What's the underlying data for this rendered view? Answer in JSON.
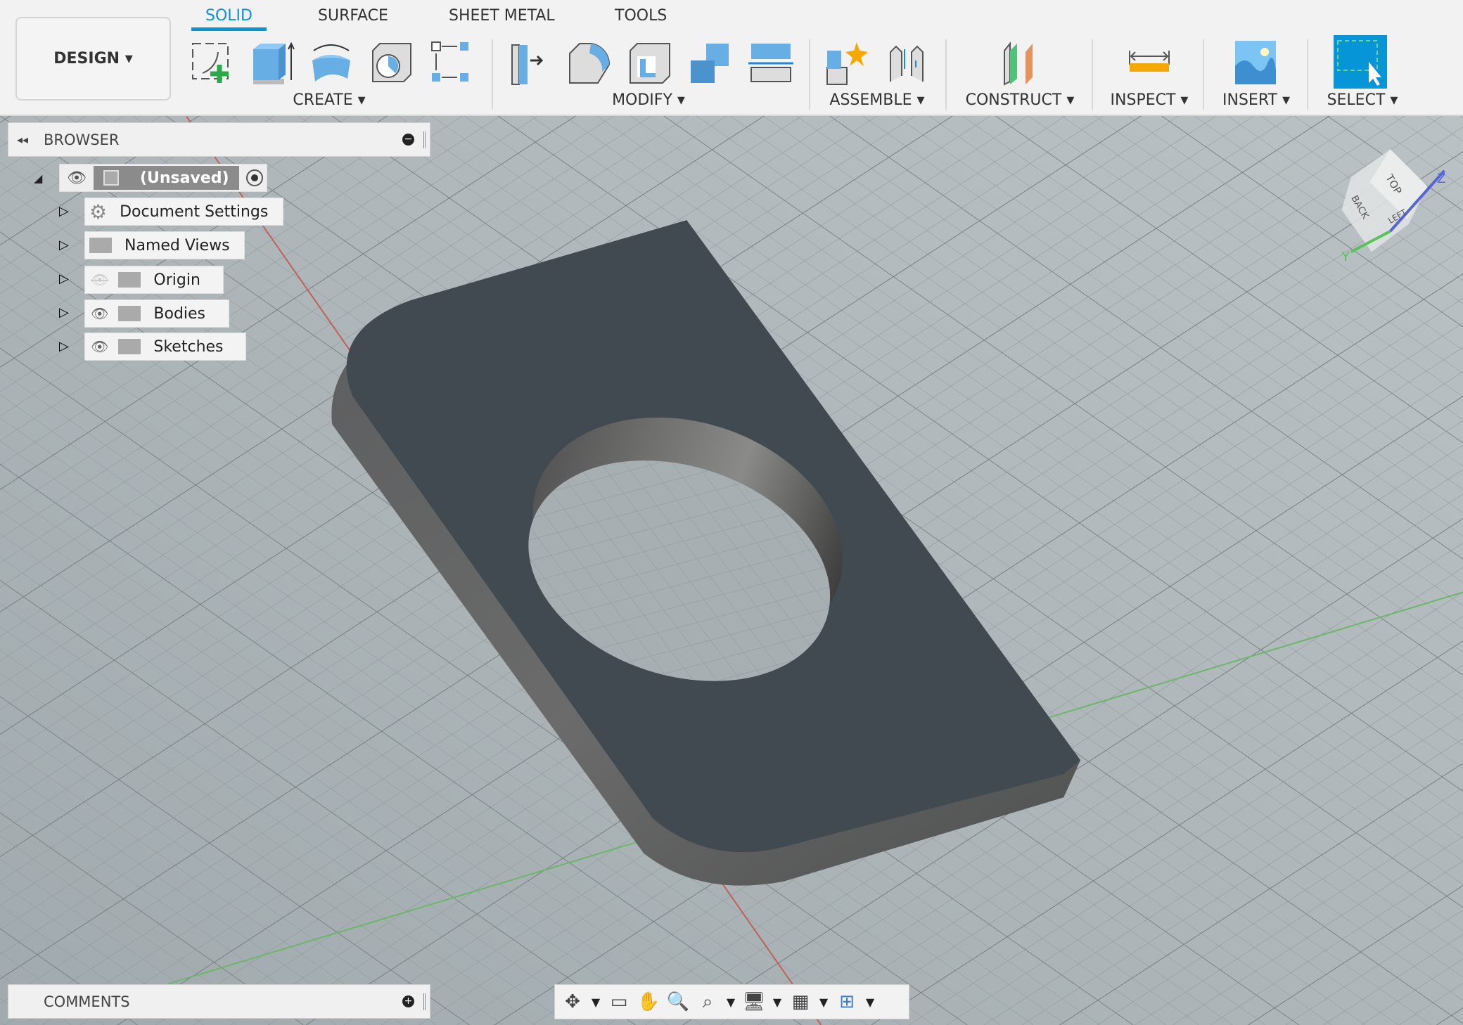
{
  "toolbar": {
    "workspace": "DESIGN",
    "tabs": [
      {
        "label": "SOLID",
        "active": true
      },
      {
        "label": "SURFACE",
        "active": false
      },
      {
        "label": "SHEET METAL",
        "active": false
      },
      {
        "label": "TOOLS",
        "active": false
      }
    ],
    "groups": [
      {
        "label": "CREATE",
        "icons": [
          "create-sketch-icon",
          "extrude-icon",
          "revolve-icon",
          "hole-icon",
          "pattern-icon"
        ]
      },
      {
        "label": "MODIFY",
        "icons": [
          "press-pull-icon",
          "fillet-icon",
          "shell-icon",
          "combine-icon",
          "split-body-icon"
        ]
      },
      {
        "label": "ASSEMBLE",
        "icons": [
          "new-component-icon",
          "joint-icon"
        ]
      },
      {
        "label": "CONSTRUCT",
        "icons": [
          "offset-plane-icon"
        ]
      },
      {
        "label": "INSPECT",
        "icons": [
          "measure-icon"
        ]
      },
      {
        "label": "INSERT",
        "icons": [
          "insert-image-icon"
        ]
      },
      {
        "label": "SELECT",
        "icons": [
          "select-icon"
        ]
      }
    ],
    "accent": "#0696d7"
  },
  "browser": {
    "title": "BROWSER",
    "root": "(Unsaved)",
    "items": [
      {
        "label": "Document Settings",
        "icon": "gear-icon"
      },
      {
        "label": "Named Views",
        "icon": "folder-icon"
      },
      {
        "label": "Origin",
        "icon": "folder-icon",
        "visible": false
      },
      {
        "label": "Bodies",
        "icon": "folder-icon",
        "visible": true
      },
      {
        "label": "Sketches",
        "icon": "folder-icon",
        "visible": true
      }
    ]
  },
  "comments": {
    "title": "COMMENTS"
  },
  "viewcube": {
    "faces": [
      "TOP",
      "BACK",
      "LEFT"
    ],
    "axes": [
      "Z",
      "Y"
    ]
  }
}
